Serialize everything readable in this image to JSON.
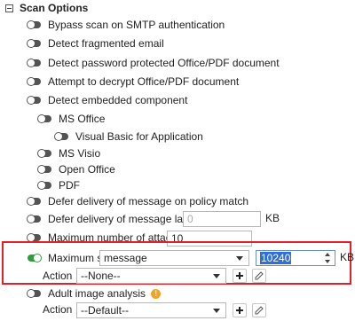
{
  "section": {
    "title": "Scan Options"
  },
  "options": {
    "bypass_smtp": "Bypass scan on SMTP authentication",
    "fragmented": "Detect fragmented email",
    "password_protected": "Detect password protected Office/PDF document",
    "decrypt": "Attempt to decrypt Office/PDF document",
    "embedded": "Detect embedded component",
    "ms_office": "MS Office",
    "vba": "Visual Basic for Application",
    "ms_visio": "MS Visio",
    "open_office": "Open Office",
    "pdf": "PDF",
    "defer_policy": "Defer delivery of message on policy match",
    "defer_larger": "Defer delivery of message larger than",
    "defer_larger_placeholder": "0",
    "defer_larger_unit": "KB",
    "max_attachment": "Maximum number of attachment",
    "max_attachment_value": "10",
    "max_size": "Maximum size",
    "max_size_select": "message",
    "max_size_value": "10240",
    "max_size_unit": "KB",
    "action_label": "Action",
    "action_value": "--None--",
    "adult_image": "Adult image analysis",
    "adult_action_label": "Action",
    "adult_action_value": "--Default--",
    "info_glyph": "!"
  },
  "colors": {
    "toggle_off": "#545454",
    "toggle_on": "#2e9e3c",
    "highlight": "#e0202a",
    "info": "#f0a22a"
  }
}
